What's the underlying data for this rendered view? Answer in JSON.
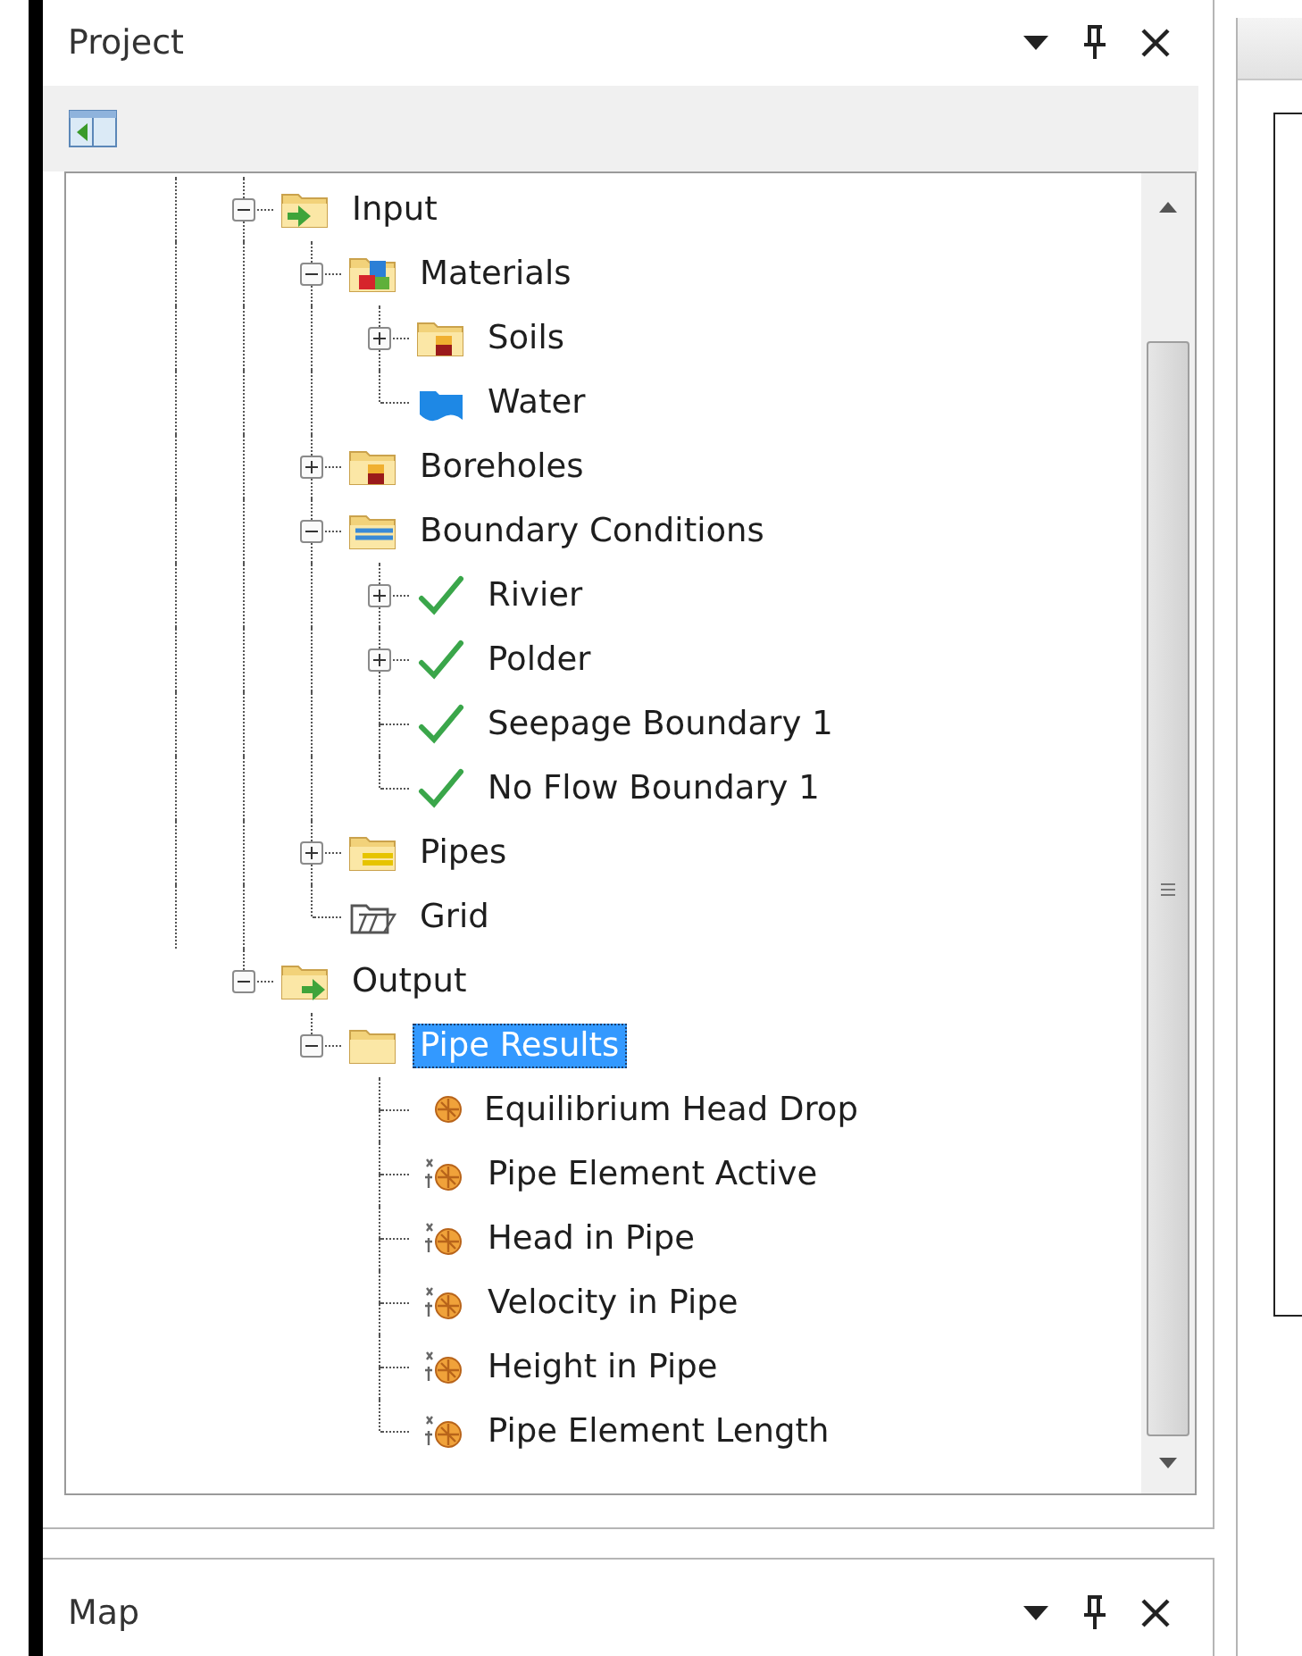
{
  "project_panel": {
    "title": "Project",
    "tree": [
      {
        "label": "Input",
        "kind": "inputs",
        "selected": false,
        "expanded": true,
        "children": [
          {
            "label": "Materials",
            "kind": "materials",
            "selected": false,
            "expanded": true,
            "children": [
              {
                "label": "Soils",
                "kind": "soils",
                "selected": false,
                "expanded": false
              },
              {
                "label": "Water",
                "kind": "water",
                "selected": false
              }
            ]
          },
          {
            "label": "Boreholes",
            "kind": "soils",
            "selected": false,
            "expanded": false
          },
          {
            "label": "Boundary Conditions",
            "kind": "boundaries",
            "selected": false,
            "expanded": true,
            "children": [
              {
                "label": "Rivier",
                "kind": "check",
                "selected": false,
                "expanded": false
              },
              {
                "label": "Polder",
                "kind": "check",
                "selected": false,
                "expanded": false
              },
              {
                "label": "Seepage Boundary 1",
                "kind": "check",
                "selected": false
              },
              {
                "label": "No Flow Boundary 1",
                "kind": "check",
                "selected": false
              }
            ]
          },
          {
            "label": "Pipes",
            "kind": "pipes",
            "selected": false,
            "expanded": false
          },
          {
            "label": "Grid",
            "kind": "grid",
            "selected": false
          }
        ]
      },
      {
        "label": "Output",
        "kind": "outputs",
        "selected": false,
        "expanded": true,
        "children": [
          {
            "label": "Pipe Results",
            "kind": "folder",
            "selected": true,
            "expanded": true,
            "children": [
              {
                "label": "Equilibrium Head Drop",
                "kind": "result",
                "selected": false
              },
              {
                "label": "Pipe Element Active",
                "kind": "series",
                "selected": false
              },
              {
                "label": "Head in Pipe",
                "kind": "series",
                "selected": false
              },
              {
                "label": "Velocity in Pipe",
                "kind": "series",
                "selected": false
              },
              {
                "label": "Height in Pipe",
                "kind": "series",
                "selected": false
              },
              {
                "label": "Pipe Element Length",
                "kind": "series",
                "selected": false
              }
            ]
          }
        ]
      }
    ]
  },
  "map_panel": {
    "title": "Map"
  }
}
